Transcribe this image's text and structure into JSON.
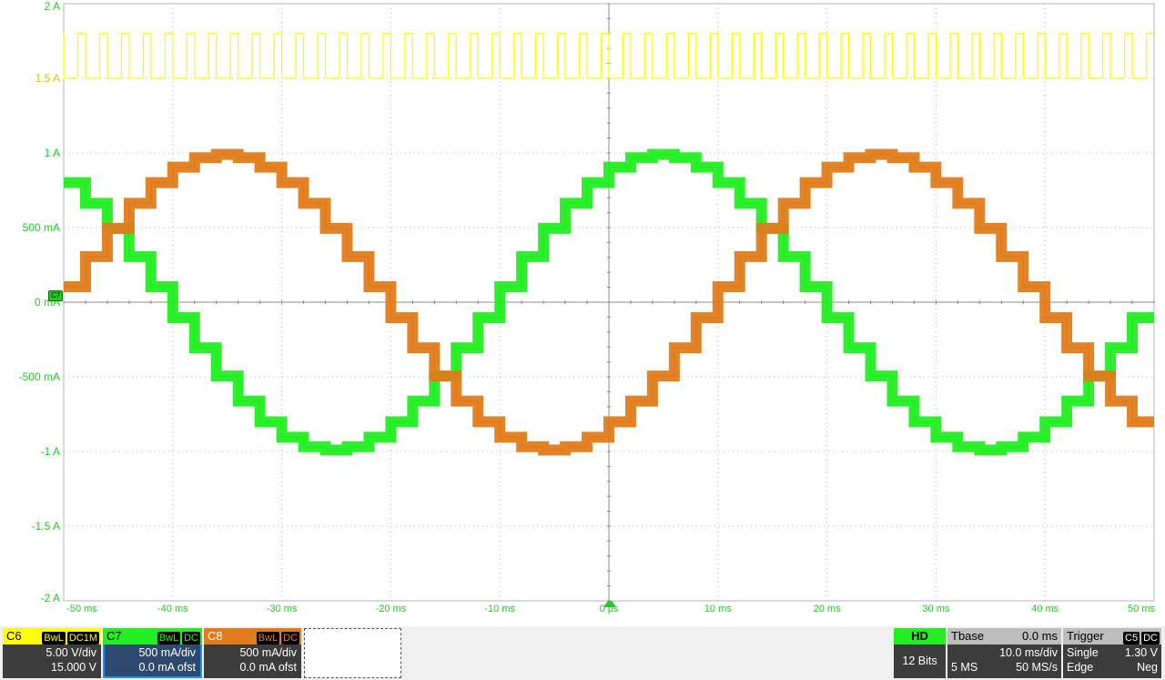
{
  "colors": {
    "c6": "#ffff00",
    "c7": "#22ee22",
    "c8": "#e07c1c",
    "grid": "#b4b4b4",
    "axis_label": "#22cc22"
  },
  "markers": {
    "c7": "C7",
    "c6": "C6"
  },
  "chart_data": {
    "type": "line",
    "x_unit": "ms",
    "xlim": [
      -50,
      50
    ],
    "ylim": [
      -2,
      2
    ],
    "x_tick_labels": [
      "-50 ms",
      "-40 ms",
      "-30 ms",
      "-20 ms",
      "-10 ms",
      "0 ps",
      "10 ms",
      "20 ms",
      "30 ms",
      "40 ms",
      "50 ms"
    ],
    "y_tick_labels": [
      "2 A",
      "1.5 A",
      "1 A",
      "500 mA",
      "0 mA",
      "-500 mA",
      "-1 A",
      "-1.5 A",
      "-2 A"
    ],
    "series": [
      {
        "channel": "C6",
        "kind": "pwm_square",
        "high": 1.8,
        "low": 1.5,
        "period_ms": 2.0,
        "duty": 0.35
      },
      {
        "channel": "C7",
        "kind": "stepped_sine",
        "amplitude": 0.99,
        "period_ms": 60,
        "phase_deg": 60,
        "step_ms": 2.0
      },
      {
        "channel": "C8",
        "kind": "stepped_sine",
        "amplitude": 0.99,
        "period_ms": 60,
        "phase_deg": -60,
        "step_ms": 2.0
      }
    ]
  },
  "status": {
    "c6": {
      "name": "C6",
      "bw": "BwL",
      "coupling": "DC1M",
      "scale": "5.00 V/div",
      "offset": "15.000 V"
    },
    "c7": {
      "name": "C7",
      "bw": "BwL",
      "coupling": "DC",
      "scale": "500 mA/div",
      "offset": "0.0 mA ofst"
    },
    "c8": {
      "name": "C8",
      "bw": "BwL",
      "coupling": "DC",
      "scale": "500 mA/div",
      "offset": "0.0 mA ofst"
    },
    "hd": {
      "label": "HD",
      "bits": "12 Bits"
    },
    "tbase": {
      "label": "Tbase",
      "value": "0.0 ms",
      "per_div": "10.0 ms/div",
      "samples": "5 MS",
      "rate": "50 MS/s"
    },
    "trigger": {
      "label": "Trigger",
      "source": "C5",
      "coupling": "DC",
      "mode": "Single",
      "level": "1.30 V",
      "type": "Edge",
      "slope": "Neg"
    }
  }
}
